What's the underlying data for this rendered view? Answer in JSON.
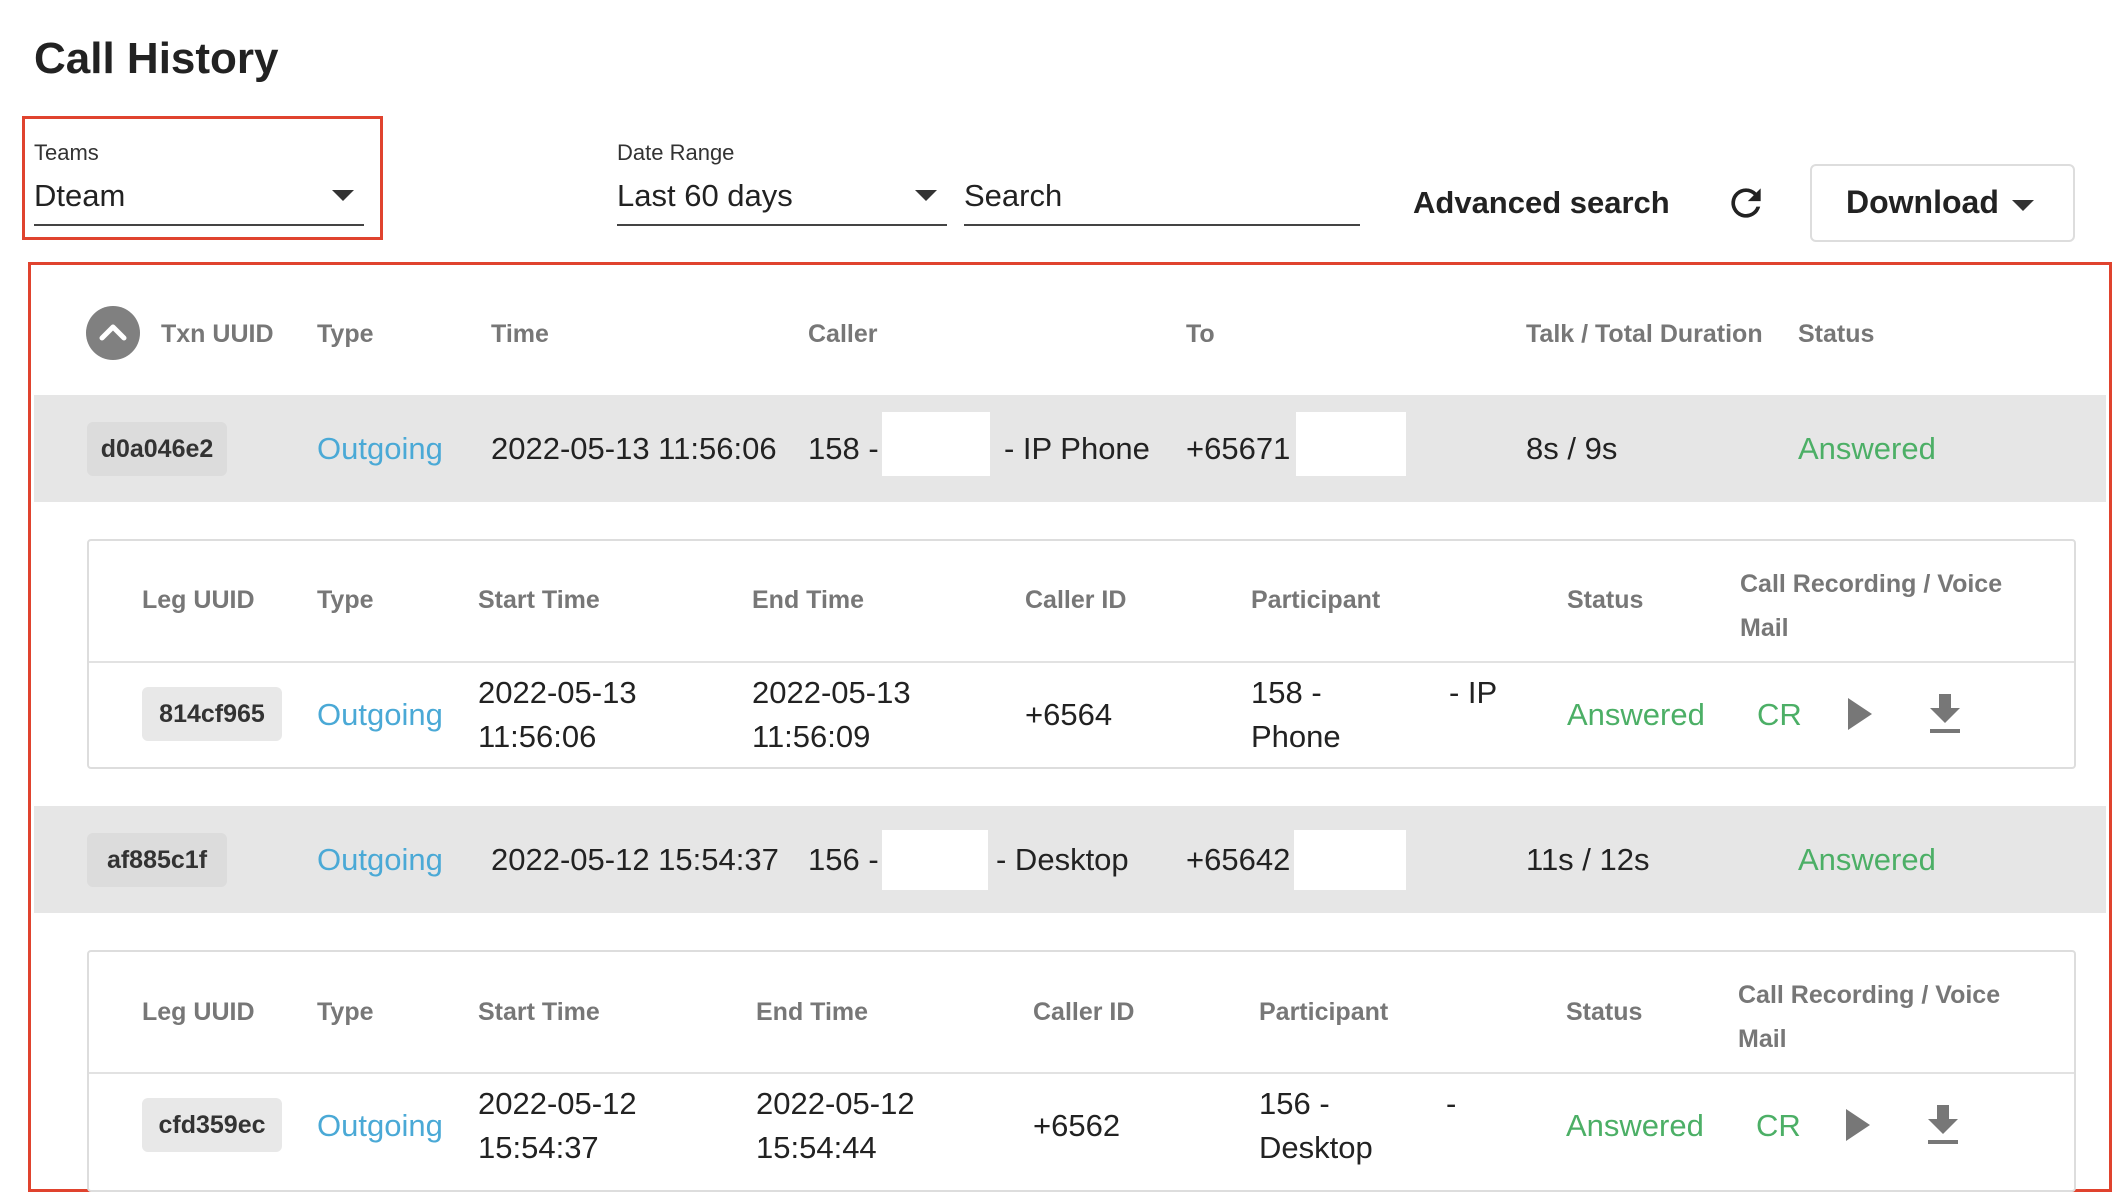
{
  "page": {
    "title": "Call History"
  },
  "filters": {
    "teams_label": "Teams",
    "teams_value": "Dteam",
    "date_label": "Date Range",
    "date_value": "Last 60 days",
    "search_placeholder": "Search",
    "advanced_search": "Advanced search",
    "download": "Download"
  },
  "table": {
    "headers": {
      "txn_uuid": "Txn UUID",
      "type": "Type",
      "time": "Time",
      "caller": "Caller",
      "to": "To",
      "duration": "Talk / Total Duration",
      "status": "Status"
    },
    "leg_headers": {
      "leg_uuid": "Leg UUID",
      "type": "Type",
      "start_time": "Start Time",
      "end_time": "End Time",
      "caller_id": "Caller ID",
      "participant": "Participant",
      "status": "Status",
      "recording": "Call Recording / Voice Mail"
    },
    "transactions": [
      {
        "uuid": "d0a046e2",
        "type": "Outgoing",
        "time": "2022-05-13 11:56:06",
        "caller_prefix": "158 -",
        "caller_suffix": "- IP Phone",
        "to": "+65671",
        "duration": "8s / 9s",
        "status": "Answered",
        "leg": {
          "uuid": "814cf965",
          "type": "Outgoing",
          "start_date": "2022-05-13",
          "start_clock": "11:56:06",
          "end_date": "2022-05-13",
          "end_clock": "11:56:09",
          "caller_id": "+6564",
          "participant_line1": "158 -",
          "participant_line1b": "- IP",
          "participant_line2": "Phone",
          "status": "Answered",
          "recording": "CR"
        }
      },
      {
        "uuid": "af885c1f",
        "type": "Outgoing",
        "time": "2022-05-12 15:54:37",
        "caller_prefix": "156 -",
        "caller_suffix": "- Desktop",
        "to": "+65642",
        "duration": "11s / 12s",
        "status": "Answered",
        "leg": {
          "uuid": "cfd359ec",
          "type": "Outgoing",
          "start_date": "2022-05-12",
          "start_clock": "15:54:37",
          "end_date": "2022-05-12",
          "end_clock": "15:54:44",
          "caller_id": "+6562",
          "participant_line1": "156 -",
          "participant_line1b": "-",
          "participant_line2": "Desktop",
          "status": "Answered",
          "recording": "CR"
        }
      }
    ]
  },
  "colors": {
    "accent_blue": "#4aa9d6",
    "status_green": "#4caf66",
    "highlight_red": "#e0432e"
  }
}
